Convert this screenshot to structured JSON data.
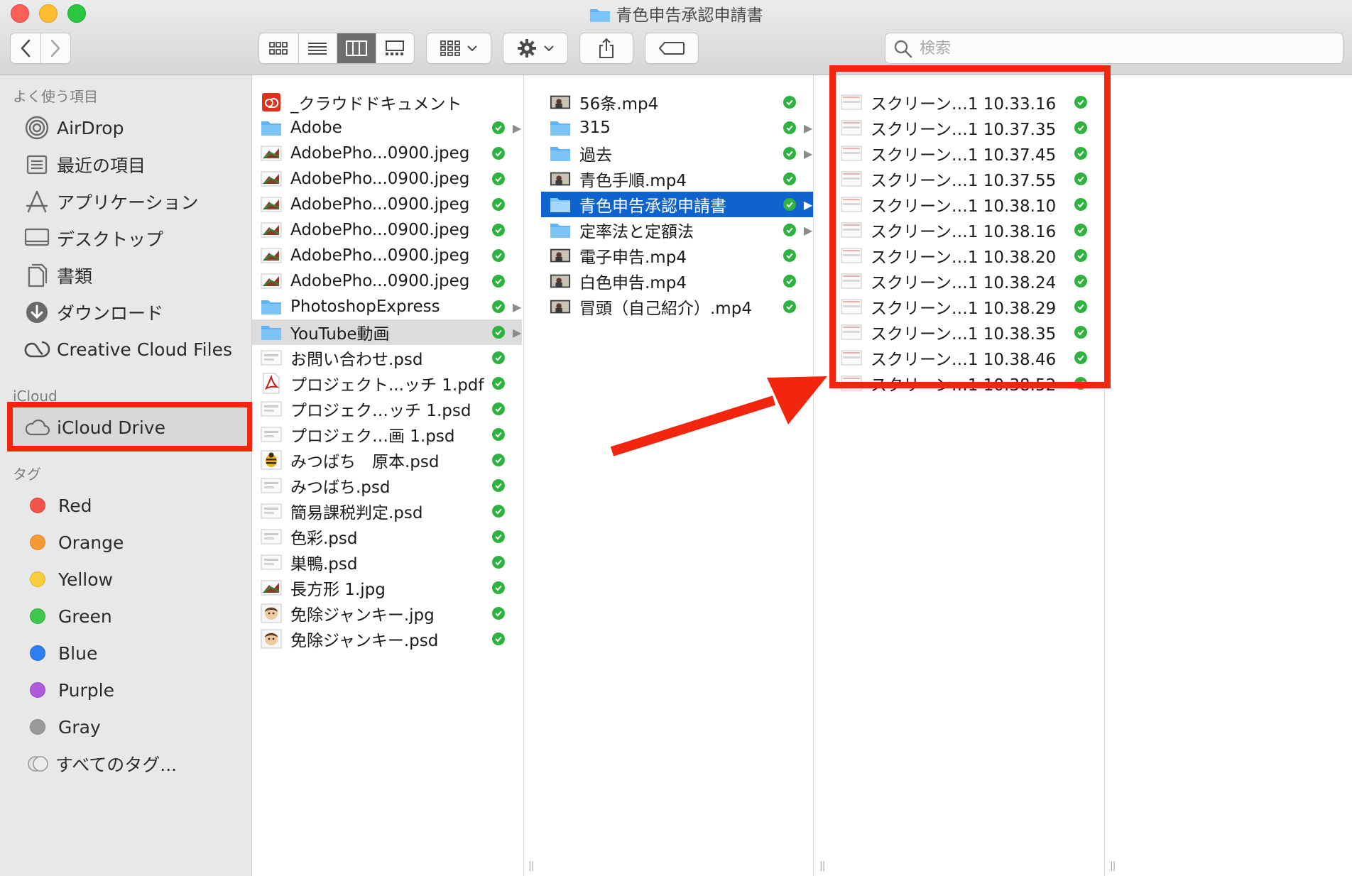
{
  "window": {
    "title": "青色申告承認申請書"
  },
  "toolbar": {
    "back_icon": "chevron-left-icon",
    "forward_icon": "chevron-right-icon",
    "view_modes": [
      "icon-view-icon",
      "list-view-icon",
      "column-view-icon",
      "gallery-view-icon"
    ],
    "active_view": "column-view-icon",
    "search_placeholder": "検索"
  },
  "sidebar": {
    "favorites_heading": "よく使う項目",
    "favorites": [
      {
        "label": "AirDrop",
        "icon": "airdrop-icon"
      },
      {
        "label": "最近の項目",
        "icon": "recents-icon"
      },
      {
        "label": "アプリケーション",
        "icon": "applications-icon"
      },
      {
        "label": "デスクトップ",
        "icon": "desktop-icon"
      },
      {
        "label": "書類",
        "icon": "documents-icon"
      },
      {
        "label": "ダウンロード",
        "icon": "downloads-icon"
      },
      {
        "label": "Creative Cloud Files",
        "icon": "creative-cloud-icon"
      }
    ],
    "icloud_heading": "iCloud",
    "icloud": [
      {
        "label": "iCloud Drive",
        "icon": "cloud-icon"
      }
    ],
    "tags_heading": "タグ",
    "tags": [
      {
        "label": "Red",
        "color": "#f2534b"
      },
      {
        "label": "Orange",
        "color": "#f49a35"
      },
      {
        "label": "Yellow",
        "color": "#f7cf3c"
      },
      {
        "label": "Green",
        "color": "#3ec64d"
      },
      {
        "label": "Blue",
        "color": "#2e7ef2"
      },
      {
        "label": "Purple",
        "color": "#b05bd9"
      },
      {
        "label": "Gray",
        "color": "#9a9a9a"
      },
      {
        "label": "すべてのタグ...",
        "color": ""
      }
    ]
  },
  "columns": {
    "col1": [
      {
        "name": "_クラウドドキュメント",
        "icon": "creative-cloud-doc-icon",
        "synced": false,
        "folder": false
      },
      {
        "name": "Adobe",
        "icon": "folder-icon",
        "synced": true,
        "folder": true
      },
      {
        "name": "AdobePho...0900.jpeg",
        "icon": "image-thumb-icon",
        "synced": true,
        "folder": false
      },
      {
        "name": "AdobePho...0900.jpeg",
        "icon": "image-thumb-icon",
        "synced": true,
        "folder": false
      },
      {
        "name": "AdobePho...0900.jpeg",
        "icon": "image-thumb-icon",
        "synced": true,
        "folder": false
      },
      {
        "name": "AdobePho...0900.jpeg",
        "icon": "image-thumb-icon",
        "synced": true,
        "folder": false
      },
      {
        "name": "AdobePho...0900.jpeg",
        "icon": "image-thumb-icon",
        "synced": true,
        "folder": false
      },
      {
        "name": "AdobePho...0900.jpeg",
        "icon": "image-thumb-icon",
        "synced": true,
        "folder": false
      },
      {
        "name": "PhotoshopExpress",
        "icon": "folder-icon",
        "synced": true,
        "folder": true
      },
      {
        "name": "YouTube動画",
        "icon": "folder-icon",
        "synced": true,
        "folder": true,
        "selected": "grey"
      },
      {
        "name": "お問い合わせ.psd",
        "icon": "psd-thumb-icon",
        "synced": true,
        "folder": false
      },
      {
        "name": "プロジェクト...ッチ 1.pdf",
        "icon": "pdf-icon",
        "synced": true,
        "folder": false
      },
      {
        "name": "プロジェク…ッチ 1.psd",
        "icon": "psd-thumb-icon",
        "synced": true,
        "folder": false
      },
      {
        "name": "プロジェク…画 1.psd",
        "icon": "psd-thumb-icon",
        "synced": true,
        "folder": false
      },
      {
        "name": "みつばち　原本.psd",
        "icon": "bee-thumb-icon",
        "synced": true,
        "folder": false
      },
      {
        "name": "みつばち.psd",
        "icon": "psd-thumb-icon",
        "synced": true,
        "folder": false
      },
      {
        "name": "簡易課税判定.psd",
        "icon": "psd-thumb-icon",
        "synced": true,
        "folder": false
      },
      {
        "name": "色彩.psd",
        "icon": "psd-thumb-icon",
        "synced": true,
        "folder": false
      },
      {
        "name": "巣鴨.psd",
        "icon": "psd-thumb-icon",
        "synced": true,
        "folder": false
      },
      {
        "name": "長方形 1.jpg",
        "icon": "image-thumb-icon",
        "synced": true,
        "folder": false
      },
      {
        "name": "免除ジャンキー.jpg",
        "icon": "face-thumb-icon",
        "synced": true,
        "folder": false
      },
      {
        "name": "免除ジャンキー.psd",
        "icon": "face-thumb-icon",
        "synced": true,
        "folder": false
      }
    ],
    "col2": [
      {
        "name": "56条.mp4",
        "icon": "video-thumb-icon",
        "synced": true,
        "folder": false
      },
      {
        "name": "315",
        "icon": "folder-icon",
        "synced": true,
        "folder": true
      },
      {
        "name": "過去",
        "icon": "folder-icon",
        "synced": true,
        "folder": true
      },
      {
        "name": "青色手順.mp4",
        "icon": "video-thumb-icon",
        "synced": true,
        "folder": false
      },
      {
        "name": "青色申告承認申請書",
        "icon": "folder-icon",
        "synced": true,
        "folder": true,
        "selected": "blue"
      },
      {
        "name": "定率法と定額法",
        "icon": "folder-icon",
        "synced": true,
        "folder": true
      },
      {
        "name": "電子申告.mp4",
        "icon": "video-thumb-icon",
        "synced": true,
        "folder": false
      },
      {
        "name": "白色申告.mp4",
        "icon": "video-thumb-icon",
        "synced": true,
        "folder": false
      },
      {
        "name": "冒頭（自己紹介）.mp4",
        "icon": "video-thumb-icon",
        "synced": true,
        "folder": false
      }
    ],
    "col3": [
      {
        "name": "スクリーン…1 10.33.16",
        "icon": "screenshot-thumb-icon",
        "synced": true,
        "folder": false
      },
      {
        "name": "スクリーン…1 10.37.35",
        "icon": "screenshot-thumb-icon",
        "synced": true,
        "folder": false
      },
      {
        "name": "スクリーン…1 10.37.45",
        "icon": "screenshot-thumb-icon",
        "synced": true,
        "folder": false
      },
      {
        "name": "スクリーン…1 10.37.55",
        "icon": "screenshot-thumb-icon",
        "synced": true,
        "folder": false
      },
      {
        "name": "スクリーン…1 10.38.10",
        "icon": "screenshot-thumb-icon",
        "synced": true,
        "folder": false
      },
      {
        "name": "スクリーン…1 10.38.16",
        "icon": "screenshot-thumb-icon",
        "synced": true,
        "folder": false
      },
      {
        "name": "スクリーン…1 10.38.20",
        "icon": "screenshot-thumb-icon",
        "synced": true,
        "folder": false
      },
      {
        "name": "スクリーン…1 10.38.24",
        "icon": "screenshot-thumb-icon",
        "synced": true,
        "folder": false
      },
      {
        "name": "スクリーン…1 10.38.29",
        "icon": "screenshot-thumb-icon",
        "synced": true,
        "folder": false
      },
      {
        "name": "スクリーン…1 10.38.35",
        "icon": "screenshot-thumb-icon",
        "synced": true,
        "folder": false
      },
      {
        "name": "スクリーン…1 10.38.46",
        "icon": "screenshot-thumb-icon",
        "synced": true,
        "folder": false
      },
      {
        "name": "スクリーン…1 10.38.52",
        "icon": "screenshot-thumb-icon",
        "synced": true,
        "folder": false
      }
    ]
  },
  "colors": {
    "annotation": "#f2260f",
    "selection_blue": "#0f63ce",
    "sync_check": "#2fb340",
    "folder": "#5fb3f5"
  }
}
